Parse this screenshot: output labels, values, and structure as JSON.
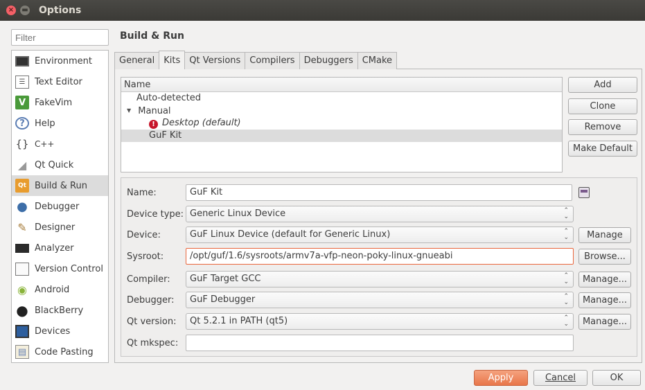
{
  "window": {
    "title": "Options",
    "close_glyph": "×",
    "min_glyph": "▬"
  },
  "filter": {
    "placeholder": "Filter"
  },
  "sidebar": {
    "items": [
      {
        "label": "Environment",
        "icon": "monitor-icon",
        "glyph": "■"
      },
      {
        "label": "Text Editor",
        "icon": "text-editor-icon",
        "glyph": "☰"
      },
      {
        "label": "FakeVim",
        "icon": "vim-icon",
        "glyph": "V"
      },
      {
        "label": "Help",
        "icon": "help-icon",
        "glyph": "?"
      },
      {
        "label": "C++",
        "icon": "cpp-braces-icon",
        "glyph": "{}"
      },
      {
        "label": "Qt Quick",
        "icon": "qt-quick-icon",
        "glyph": "◢"
      },
      {
        "label": "Build & Run",
        "icon": "build-run-icon",
        "glyph": "Qt",
        "selected": true
      },
      {
        "label": "Debugger",
        "icon": "debugger-icon",
        "glyph": "●"
      },
      {
        "label": "Designer",
        "icon": "designer-icon",
        "glyph": "✎"
      },
      {
        "label": "Analyzer",
        "icon": "analyzer-icon",
        "glyph": "▬"
      },
      {
        "label": "Version Control",
        "icon": "version-control-icon",
        "glyph": "▯"
      },
      {
        "label": "Android",
        "icon": "android-icon",
        "glyph": "◉"
      },
      {
        "label": "BlackBerry",
        "icon": "blackberry-icon",
        "glyph": "●"
      },
      {
        "label": "Devices",
        "icon": "devices-icon",
        "glyph": "▮"
      },
      {
        "label": "Code Pasting",
        "icon": "code-pasting-icon",
        "glyph": "▤"
      }
    ]
  },
  "section_title": "Build & Run",
  "tabs": [
    {
      "label": "General"
    },
    {
      "label": "Kits",
      "active": true
    },
    {
      "label": "Qt Versions"
    },
    {
      "label": "Compilers"
    },
    {
      "label": "Debuggers"
    },
    {
      "label": "CMake"
    }
  ],
  "kits": {
    "header": "Name",
    "auto_detected": "Auto-detected",
    "manual": "Manual",
    "expand_glyph": "▼",
    "desktop": "Desktop (default)",
    "warn_glyph": "!",
    "guf_kit": "GuF Kit"
  },
  "kit_buttons": {
    "add": "Add",
    "clone": "Clone",
    "remove": "Remove",
    "make_default": "Make Default"
  },
  "form": {
    "name_label": "Name:",
    "name_value": "GuF Kit",
    "device_type_label": "Device type:",
    "device_type_value": "Generic Linux Device",
    "device_label": "Device:",
    "device_value": "GuF Linux Device (default for Generic Linux)",
    "device_button": "Manage",
    "sysroot_label": "Sysroot:",
    "sysroot_value": "/opt/guf/1.6/sysroots/armv7a-vfp-neon-poky-linux-gnueabi",
    "sysroot_button": "Browse...",
    "compiler_label": "Compiler:",
    "compiler_value": "GuF Target GCC",
    "compiler_button": "Manage...",
    "debugger_label": "Debugger:",
    "debugger_value": "GuF Debugger",
    "debugger_button": "Manage...",
    "qt_version_label": "Qt version:",
    "qt_version_value": "Qt 5.2.1 in PATH (qt5)",
    "qt_version_button": "Manage...",
    "qt_mkspec_label": "Qt mkspec:",
    "qt_mkspec_value": "",
    "combo_arrows_up": "⌃",
    "combo_arrows_down": "⌄"
  },
  "dialog_buttons": {
    "apply": "Apply",
    "cancel": "Cancel",
    "ok": "OK"
  },
  "colors": {
    "accent": "#e9653b",
    "selection": "#dcdcdc",
    "titlebar": "#3b3a36",
    "warning": "#c7162b"
  }
}
